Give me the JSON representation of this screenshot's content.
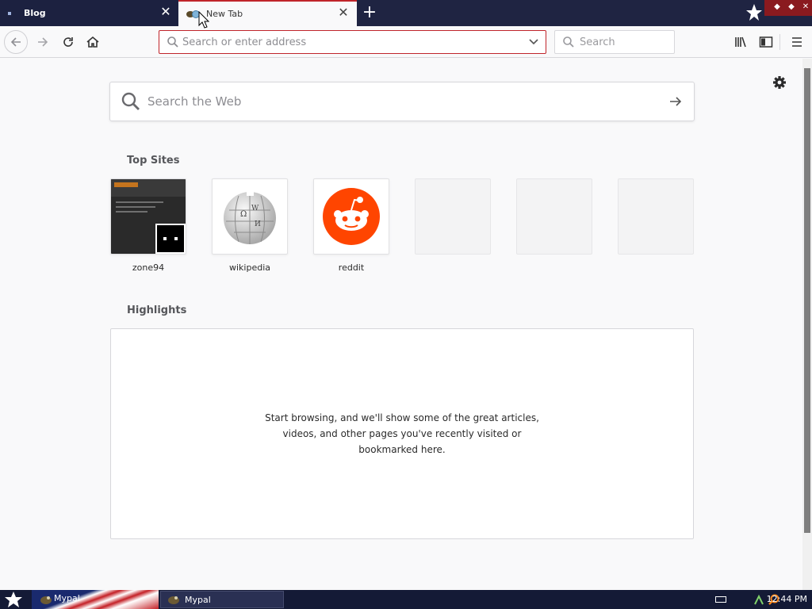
{
  "tabs": [
    {
      "title": "Blog",
      "active": false
    },
    {
      "title": "New Tab",
      "active": true
    }
  ],
  "toolbar": {
    "url_placeholder": "Search or enter address",
    "search_placeholder": "Search"
  },
  "newtab": {
    "search_placeholder": "Search the Web",
    "top_sites_title": "Top Sites",
    "top_sites": [
      {
        "label": "zone94",
        "icon": "zone94-screenshot"
      },
      {
        "label": "wikipedia",
        "icon": "wikipedia-globe-icon"
      },
      {
        "label": "reddit",
        "icon": "reddit-alien-icon"
      },
      {
        "label": "",
        "icon": ""
      },
      {
        "label": "",
        "icon": ""
      },
      {
        "label": "",
        "icon": ""
      }
    ],
    "highlights_title": "Highlights",
    "highlights_empty_message": "Start browsing, and we'll show some of the great articles, videos, and other pages you've recently visited or bookmarked here."
  },
  "taskbar": {
    "quicklaunch_label": "Mypal",
    "task_label": "Mypal",
    "clock": "12:44 PM"
  },
  "colors": {
    "tabstrip": "#1f2442",
    "accent_red": "#c0242a",
    "reddit_orange": "#ff4500",
    "content_bg": "#f9f9fa"
  }
}
